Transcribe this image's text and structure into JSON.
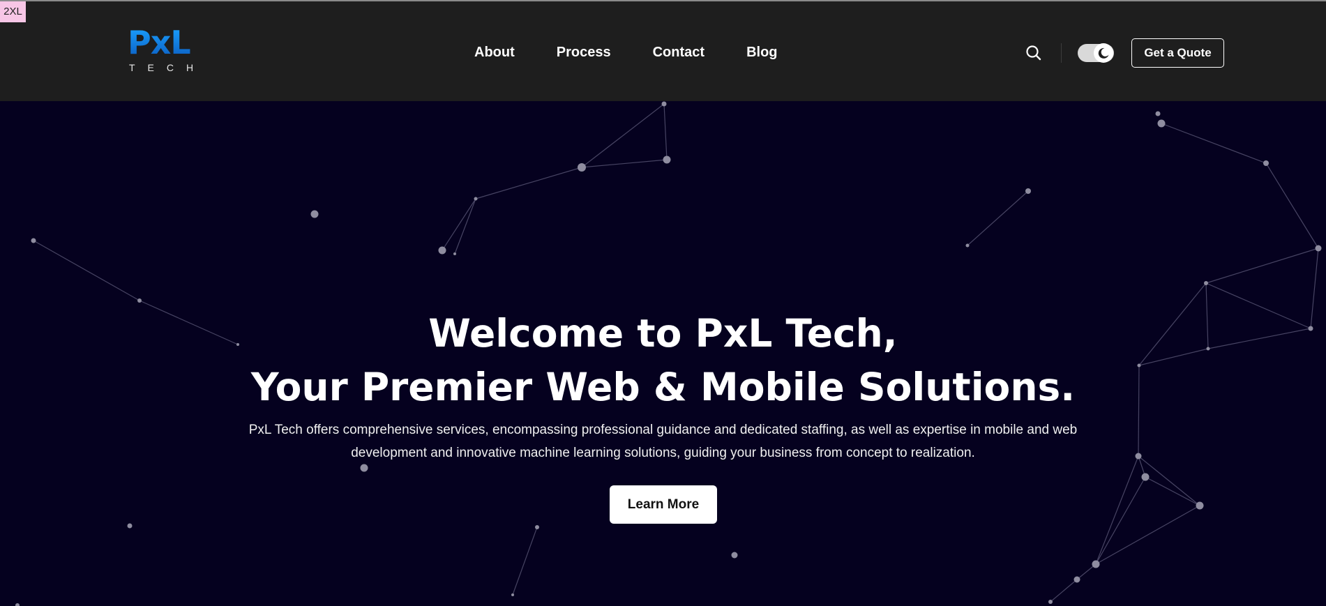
{
  "breakpoint_badge": "2XL",
  "logo": {
    "mark": "PxL",
    "sub": "TECH"
  },
  "nav": {
    "items": [
      {
        "label": "About"
      },
      {
        "label": "Process"
      },
      {
        "label": "Contact"
      },
      {
        "label": "Blog"
      }
    ]
  },
  "header_actions": {
    "search_icon": "search-icon",
    "theme_toggle_icon": "moon-icon",
    "quote_label": "Get a Quote"
  },
  "hero": {
    "title_line1": "Welcome to PxL Tech,",
    "title_line2": "Your Premier Web & Mobile Solutions.",
    "description": "PxL Tech offers comprehensive services, encompassing professional guidance and dedicated staffing, as well as expertise in mobile and web development and innovative machine learning solutions, guiding your business from concept to realization.",
    "cta_label": "Learn More"
  },
  "colors": {
    "header_bg": "#1e1e1e",
    "hero_bg": "#05011f",
    "logo_blue": "#1a8fff",
    "particle": "#9a98a8",
    "badge_bg": "#f7c6e6"
  }
}
